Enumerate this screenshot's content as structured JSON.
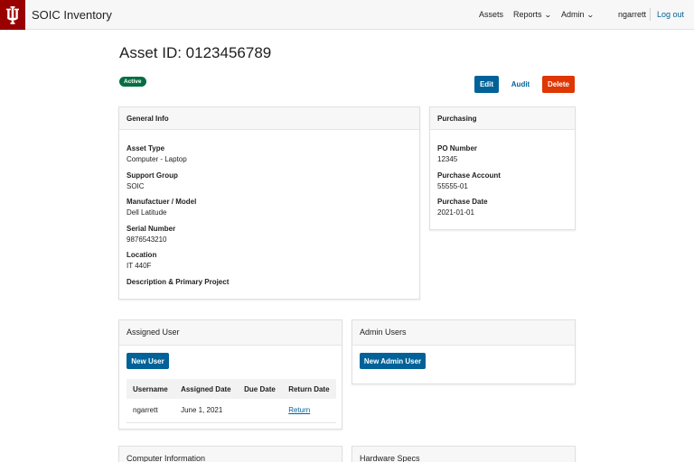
{
  "header": {
    "app_title": "SOIC Inventory",
    "nav": {
      "assets": "Assets",
      "reports": "Reports",
      "admin": "Admin",
      "username": "ngarrett",
      "logout": "Log out"
    }
  },
  "asset": {
    "title": "Asset ID: 0123456789",
    "status": "Active",
    "actions": {
      "edit": "Edit",
      "audit": "Audit",
      "delete": "Delete"
    }
  },
  "general_info": {
    "heading": "General Info",
    "fields": [
      {
        "label": "Asset Type",
        "value": "Computer - Laptop"
      },
      {
        "label": "Support Group",
        "value": "SOIC"
      },
      {
        "label": "Manufactuer / Model",
        "value": "Dell Latitude"
      },
      {
        "label": "Serial Number",
        "value": "9876543210"
      },
      {
        "label": "Location",
        "value": "IT 440F"
      },
      {
        "label": "Description & Primary Project",
        "value": ""
      }
    ]
  },
  "purchasing": {
    "heading": "Purchasing",
    "fields": [
      {
        "label": "PO Number",
        "value": "12345"
      },
      {
        "label": "Purchase Account",
        "value": "55555-01"
      },
      {
        "label": "Purchase Date",
        "value": "2021-01-01"
      }
    ]
  },
  "assigned_user": {
    "heading": "Assigned User",
    "new_button": "New User",
    "columns": [
      "Username",
      "Assigned Date",
      "Due Date",
      "Return Date"
    ],
    "rows": [
      {
        "username": "ngarrett",
        "assigned_date": "June 1, 2021",
        "due_date": "",
        "return_link": "Return"
      }
    ]
  },
  "admin_users": {
    "heading": "Admin Users",
    "new_button": "New Admin User"
  },
  "computer_information": {
    "heading": "Computer Information"
  },
  "hardware_specs": {
    "heading": "Hardware Specs"
  },
  "colors": {
    "brand": "#990000",
    "primary": "#006298",
    "danger": "#df3603",
    "success": "#056e41"
  },
  "icons": {
    "logo": "trident-logo-icon",
    "dropdown": "chevron-down-icon"
  }
}
